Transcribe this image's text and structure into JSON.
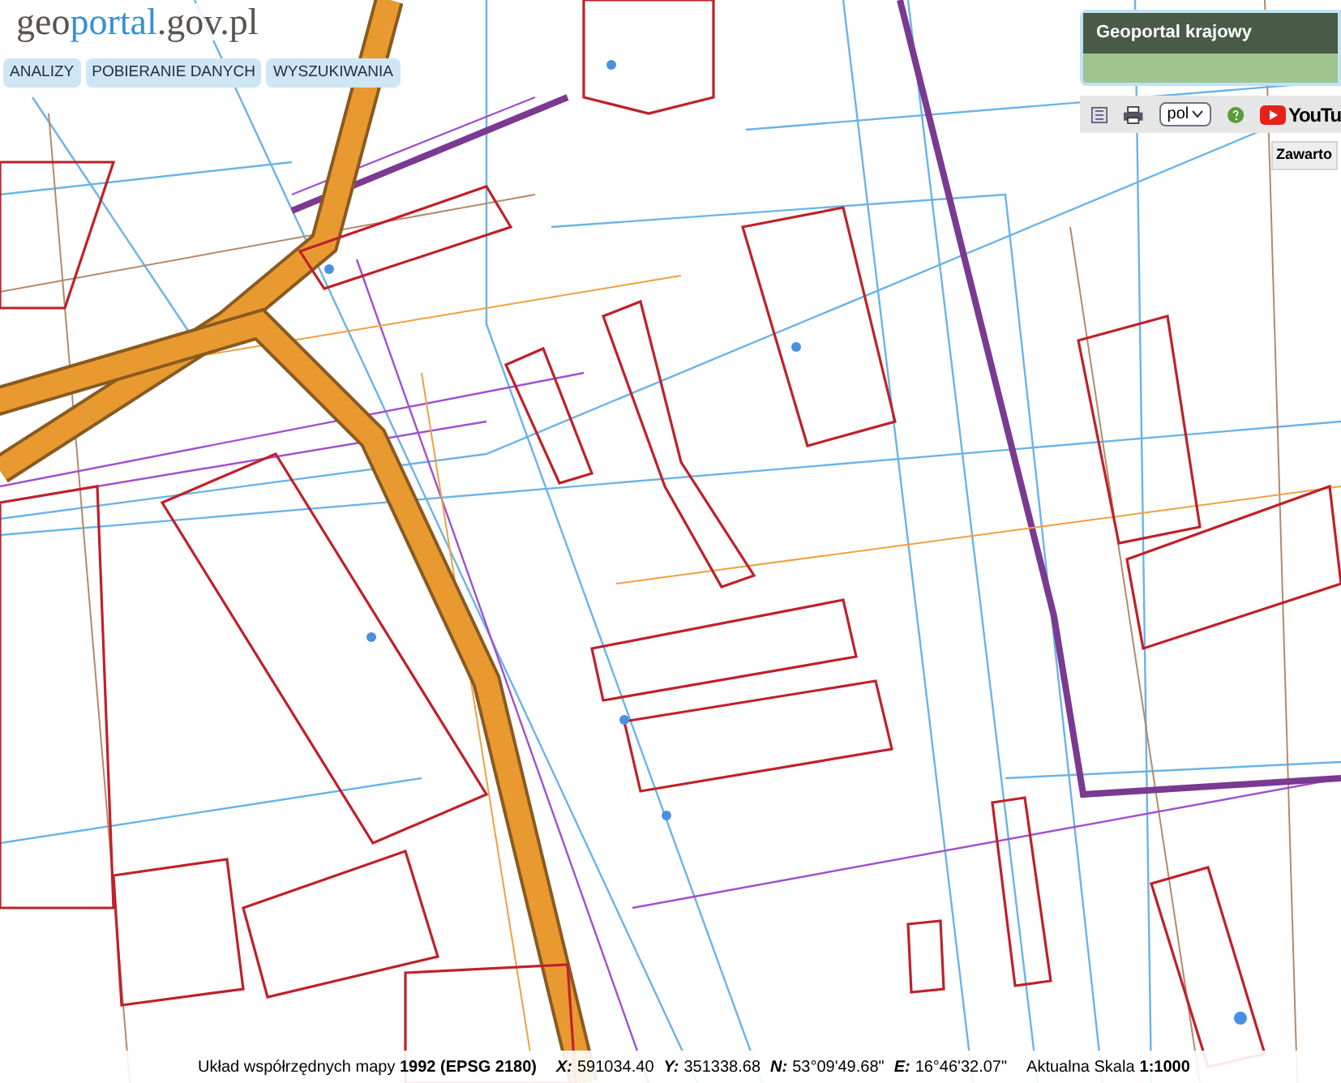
{
  "logo": {
    "parts": [
      {
        "text": "geo",
        "kind": "dark"
      },
      {
        "text": "portal",
        "kind": "accent"
      },
      {
        "text": ".gov.pl",
        "kind": "dark"
      }
    ]
  },
  "menu": [
    {
      "label": "ANALIZY"
    },
    {
      "label": "POBIERANIE DANYCH"
    },
    {
      "label": "WYSZUKIWANIA"
    }
  ],
  "overview_map": {
    "title": "Geoportal krajowy"
  },
  "toolbar": {
    "language": "pol",
    "video_label": "YouTu",
    "tooltip": "Zawarto"
  },
  "status_bar": {
    "coordinate_system": "Układ współrzędnych mapy **1992 (EPSG 2180)**",
    "coordinates": [
      {
        "label": "X:",
        "value": "591034.40"
      },
      {
        "label": "Y:",
        "value": "351338.68"
      },
      {
        "label": "N:",
        "value": "53°09'49.68\""
      },
      {
        "label": "E:",
        "value": "16°46'32.07\""
      }
    ],
    "scale_label": "Aktualna Skala",
    "scale_value": "1:1000"
  }
}
